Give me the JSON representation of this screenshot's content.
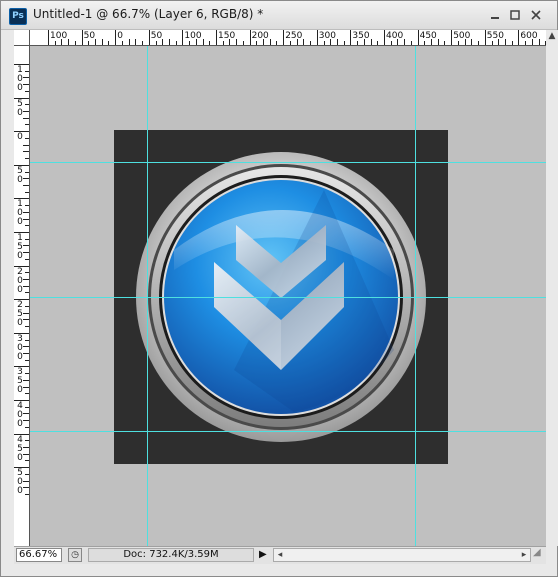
{
  "window": {
    "title": "Untitled-1 @ 66.7% (Layer 6, RGB/8) *",
    "app_icon_label": "Ps",
    "minimize_icon": "minimize-icon",
    "maximize_icon": "maximize-icon",
    "close_icon": "close-icon"
  },
  "ruler_h": {
    "labels": [
      "100",
      "50",
      "0",
      "50",
      "100",
      "150",
      "200",
      "250",
      "300",
      "350",
      "400",
      "450",
      "500",
      "550",
      "600"
    ]
  },
  "ruler_v": {
    "labels": [
      "100",
      "50",
      "0",
      "50",
      "100",
      "150",
      "200",
      "250",
      "300",
      "350",
      "400",
      "450",
      "500"
    ]
  },
  "status": {
    "zoom": "66.67%",
    "doc": "Doc: 732.4K/3.59M",
    "menu_arrow": "▶"
  },
  "colors": {
    "canvas_bg": "#c0c0c0",
    "artboard": "#2e2e2e",
    "guide": "#4ee0e0",
    "button_blue": "#1f8ee6"
  }
}
